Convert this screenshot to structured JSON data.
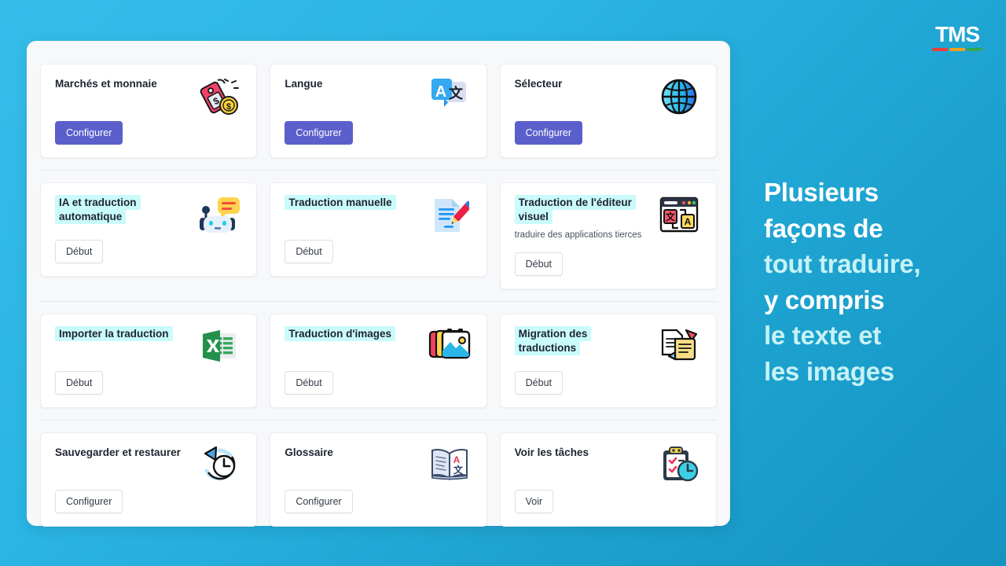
{
  "logo": {
    "text": "TMS",
    "bars": [
      "#e8413c",
      "#f0a020",
      "#33a852"
    ]
  },
  "colors": {
    "bg_start": "#35bdea",
    "bg_end": "#1593c2",
    "primary_button": "#5a5fcb",
    "highlight": "#c9fbfb",
    "headline_white": "#ffffff",
    "headline_cyan": "#c6f2f6"
  },
  "panel": {
    "sections": [
      {
        "id": "setup",
        "cards": [
          {
            "title": "Marchés et monnaie",
            "subtitle": "",
            "highlight": false,
            "icon": "price-tag-coin-icon",
            "button": {
              "label": "Configurer",
              "style": "primary"
            }
          },
          {
            "title": "Langue",
            "subtitle": "",
            "highlight": false,
            "icon": "language-translate-icon",
            "button": {
              "label": "Configurer",
              "style": "primary"
            }
          },
          {
            "title": "Sélecteur",
            "subtitle": "",
            "highlight": false,
            "icon": "globe-icon",
            "button": {
              "label": "Configurer",
              "style": "primary"
            }
          }
        ]
      },
      {
        "id": "translate-methods",
        "cards": [
          {
            "title": "IA et traduction automatique",
            "subtitle": "",
            "highlight": true,
            "icon": "robot-chat-icon",
            "button": {
              "label": "Début",
              "style": "secondary"
            }
          },
          {
            "title": "Traduction manuelle",
            "subtitle": "",
            "highlight": true,
            "icon": "document-pencil-icon",
            "button": {
              "label": "Début",
              "style": "secondary"
            }
          },
          {
            "title": "Traduction de l'éditeur visuel",
            "subtitle": "traduire des applications tierces",
            "highlight": true,
            "icon": "visual-editor-window-icon",
            "button": {
              "label": "Début",
              "style": "secondary"
            }
          }
        ]
      },
      {
        "id": "import-migrate",
        "cards": [
          {
            "title": "Importer la traduction",
            "subtitle": "",
            "highlight": true,
            "icon": "excel-spreadsheet-icon",
            "button": {
              "label": "Début",
              "style": "secondary"
            }
          },
          {
            "title": "Traduction d'images",
            "subtitle": "",
            "highlight": true,
            "icon": "images-stack-icon",
            "button": {
              "label": "Début",
              "style": "secondary"
            }
          },
          {
            "title": "Migration des traductions",
            "subtitle": "",
            "highlight": true,
            "icon": "documents-migration-icon",
            "button": {
              "label": "Début",
              "style": "secondary"
            }
          }
        ]
      },
      {
        "id": "tools",
        "cards": [
          {
            "title": "Sauvegarder et restaurer",
            "subtitle": "",
            "highlight": false,
            "icon": "backup-restore-clock-icon",
            "button": {
              "label": "Configurer",
              "style": "secondary"
            }
          },
          {
            "title": "Glossaire",
            "subtitle": "",
            "highlight": false,
            "icon": "open-book-icon",
            "button": {
              "label": "Configurer",
              "style": "secondary"
            }
          },
          {
            "title": "Voir les tâches",
            "subtitle": "",
            "highlight": false,
            "icon": "clipboard-clock-icon",
            "button": {
              "label": "Voir",
              "style": "secondary"
            }
          }
        ]
      }
    ]
  },
  "headline": {
    "lines": [
      {
        "text": "Plusieurs",
        "color": "white"
      },
      {
        "text": "façons de",
        "color": "white"
      },
      {
        "text": "tout traduire,",
        "color": "cyan"
      },
      {
        "text": "y compris",
        "color": "white"
      },
      {
        "text": "le texte et",
        "color": "cyan"
      },
      {
        "text": "les images",
        "color": "cyan"
      }
    ]
  }
}
